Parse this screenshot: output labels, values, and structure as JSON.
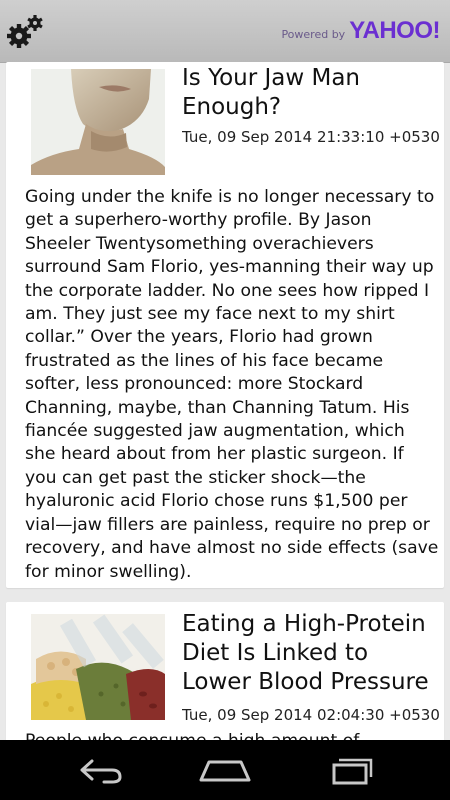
{
  "header": {
    "settings_icon": "gears-icon",
    "powered_label": "Powered by",
    "powered_brand": "YAHOO!",
    "brand_color": "#6b2fd1"
  },
  "articles": [
    {
      "title": "Is Your Jaw Man Enough?",
      "date": "Tue, 09 Sep 2014 21:33:10 +0530",
      "body": "Going under the knife is no longer necessary to get a superhero-worthy profile.  By Jason Sheeler Twentysomething overachievers surround Sam Florio, yes-manning their way up the corporate ladder. No one sees how ripped I am. They just see my face next to my shirt collar.” Over the years, Florio had grown frustrated as the lines of his face became softer, less pronounced: more Stockard Channing, maybe, than Channing Tatum. His fiancée suggested jaw augmentation, which she heard about from her plastic surgeon. If you can get past the sticker shock—the hyaluronic acid Florio chose runs $1,500 per vial—jaw fillers are painless, require no prep or recovery, and have almost no side effects (save for minor swelling)."
    },
    {
      "title": "Eating a High-Protein Diet Is Linked to Lower Blood Pressure",
      "date": "Tue, 09 Sep 2014 02:04:30 +0530",
      "body": "People who consume a high amount of"
    }
  ],
  "navbar": {
    "back_icon": "back-icon",
    "home_icon": "home-icon",
    "recents_icon": "recent-apps-icon"
  }
}
